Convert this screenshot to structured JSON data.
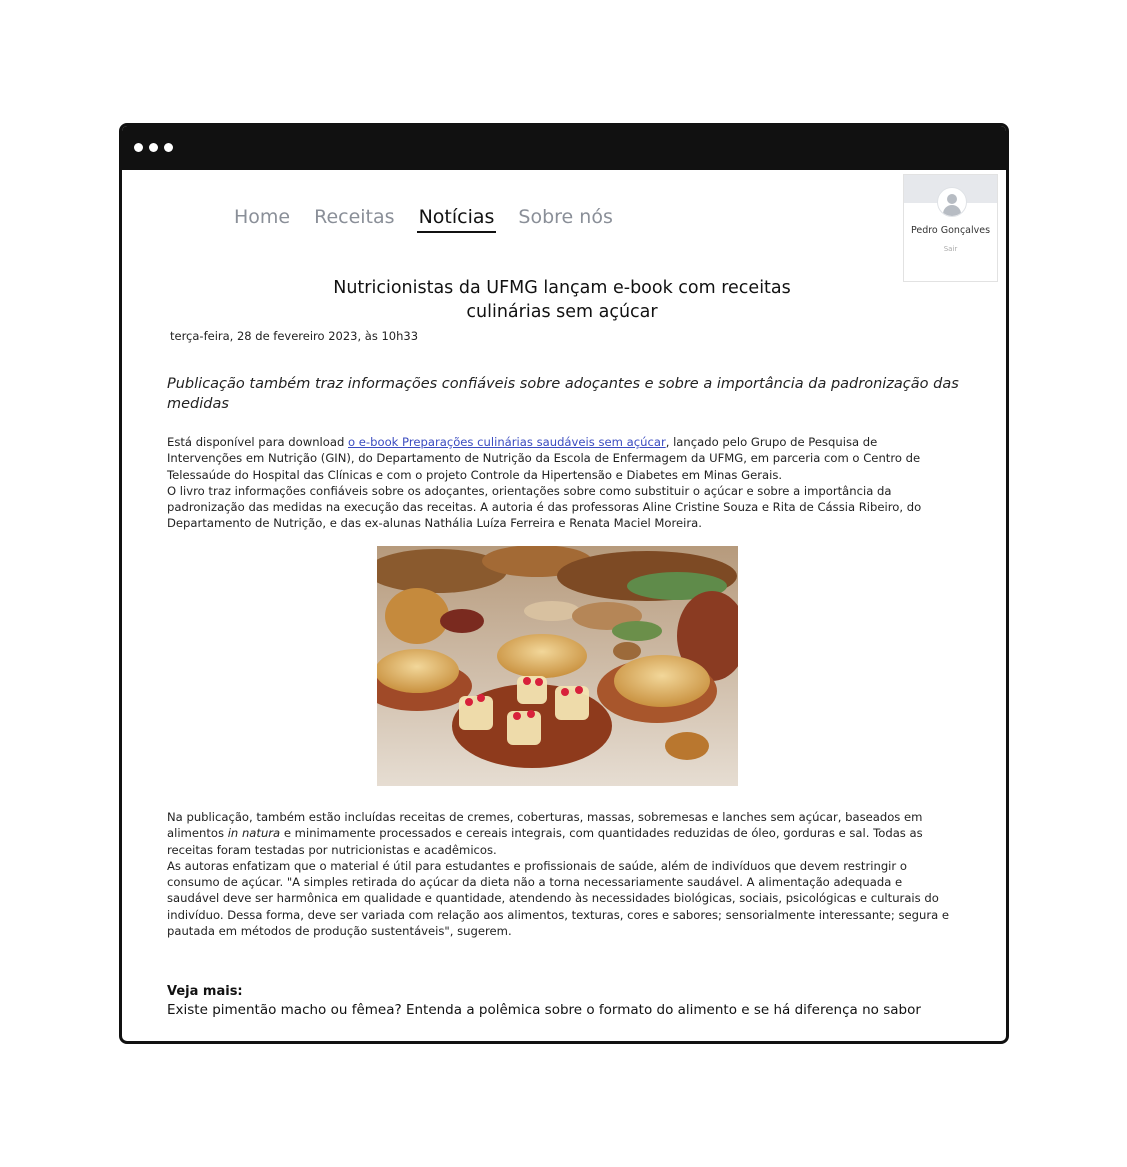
{
  "nav": {
    "items": [
      {
        "label": "Home",
        "active": false
      },
      {
        "label": "Receitas",
        "active": false
      },
      {
        "label": "Notícias",
        "active": true
      },
      {
        "label": "Sobre nós",
        "active": false
      }
    ]
  },
  "user": {
    "name": "Pedro Gonçalves",
    "logout": "Sair",
    "avatar_icon": "user-avatar-icon"
  },
  "article": {
    "title_line1": "Nutricionistas da UFMG lançam e-book com receitas",
    "title_line2": "culinárias sem açúcar",
    "date": "terça-feira, 28 de fevereiro 2023, às 10h33",
    "subtitle": "Publicação também traz informações confiáveis sobre adoçantes e sobre a importância da padronização das medidas",
    "p1_before": "Está disponível para download ",
    "p1_link": "o e-book Preparações culinárias saudáveis sem açúcar",
    "p1_after": ", lançado pelo Grupo de Pesquisa de Intervenções em Nutrição (GIN), do Departamento de Nutrição da Escola de Enfermagem da UFMG, em parceria com o Centro de Telessaúde do Hospital das Clínicas e com o projeto Controle da Hipertensão e Diabetes em Minas Gerais.",
    "p2": "O livro traz informações confiáveis sobre os adoçantes, orientações sobre como substituir o açúcar e sobre a importância da padronização das medidas na execução das receitas. A autoria é das professoras Aline Cristine Souza e Rita de Cássia Ribeiro, do Departamento de Nutrição, e das ex-alunas Nathália Luíza Ferreira e Renata Maciel Moreira.",
    "p3_before": "Na publicação, também estão incluídas receitas de cremes, coberturas, massas, sobremesas e lanches sem açúcar, baseados em alimentos ",
    "p3_em": "in natura",
    "p3_after": " e minimamente processados e cereais integrais, com quantidades reduzidas de óleo, gorduras e sal. Todas as receitas foram testadas por nutricionistas e acadêmicos.",
    "p4": "As autoras enfatizam que o material é útil para estudantes e profissionais de saúde, além de indivíduos que devem restringir o consumo de açúcar. \"A simples retirada do açúcar da dieta não a torna necessariamente saudável. A alimentação adequada e saudável deve ser harmônica em qualidade e quantidade, atendendo às necessidades biológicas, sociais, psicológicas e culturais do indivíduo. Dessa forma, deve ser variada com relação aos alimentos, texturas, cores e sabores; sensorialmente interessante; segura e pautada em métodos de produção sustentáveis\", sugerem.",
    "see_more_label": "Veja mais:",
    "related": "Existe pimentão macho ou fêmea? Entenda a polêmica sobre o formato do alimento e se há diferença no sabor"
  },
  "colors": {
    "titlebar": "#111111",
    "nav_inactive": "#8a8f98",
    "link": "#3b4cc0"
  }
}
